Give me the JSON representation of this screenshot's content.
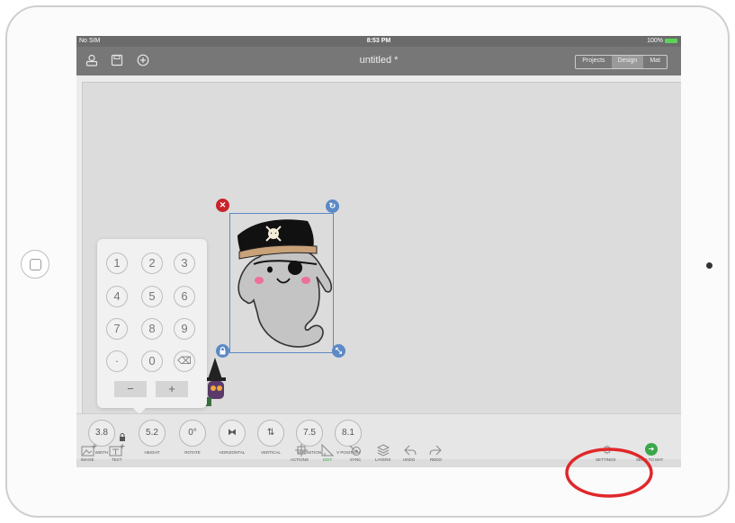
{
  "status": {
    "carrier": "No SIM",
    "time": "8:53 PM",
    "battery": "100%"
  },
  "document": {
    "title": "untitled *"
  },
  "top_icons": [
    "user-icon",
    "save-icon",
    "add-icon"
  ],
  "tabs": [
    {
      "label": "Projects",
      "active": false
    },
    {
      "label": "Design",
      "active": true
    },
    {
      "label": "Mat",
      "active": false
    }
  ],
  "keypad": {
    "keys": [
      "1",
      "2",
      "3",
      "4",
      "5",
      "6",
      "7",
      "8",
      "9",
      "·",
      "0",
      "⌫"
    ],
    "minus": "−",
    "plus": "+"
  },
  "properties": [
    {
      "value": "3.8",
      "label": "WIDTH"
    },
    {
      "value": "5.2",
      "label": "HEIGHT"
    },
    {
      "value": "0°",
      "label": "ROTATE"
    },
    {
      "value": "⧓",
      "label": "HORIZONTAL"
    },
    {
      "value": "⇅",
      "label": "VERTICAL"
    },
    {
      "value": "7.5",
      "label": "H POSITION"
    },
    {
      "value": "8.1",
      "label": "V POSITION"
    }
  ],
  "bottom_left": [
    {
      "label": "IMAGE",
      "icon": "image-icon"
    },
    {
      "label": "TEXT",
      "icon": "text-icon"
    }
  ],
  "bottom_center": [
    {
      "label": "ACTIONS",
      "icon": "actions-icon",
      "active": false
    },
    {
      "label": "EDIT",
      "icon": "edit-icon",
      "active": true
    },
    {
      "label": "SYNC",
      "icon": "sync-icon",
      "active": false
    },
    {
      "label": "LAYERS",
      "icon": "layers-icon",
      "active": false
    },
    {
      "label": "UNDO",
      "icon": "undo-icon",
      "active": false
    },
    {
      "label": "REDO",
      "icon": "redo-icon",
      "active": false
    }
  ],
  "bottom_right": [
    {
      "label": "SETTINGS",
      "icon": "gear-icon"
    },
    {
      "label": "SEND TO MAT",
      "icon": "send-icon"
    }
  ],
  "colors": {
    "accent_green": "#3ba64a",
    "selection_blue": "#5b8ac6",
    "delete_red": "#c8242b",
    "annotation_red": "#e0282a"
  }
}
